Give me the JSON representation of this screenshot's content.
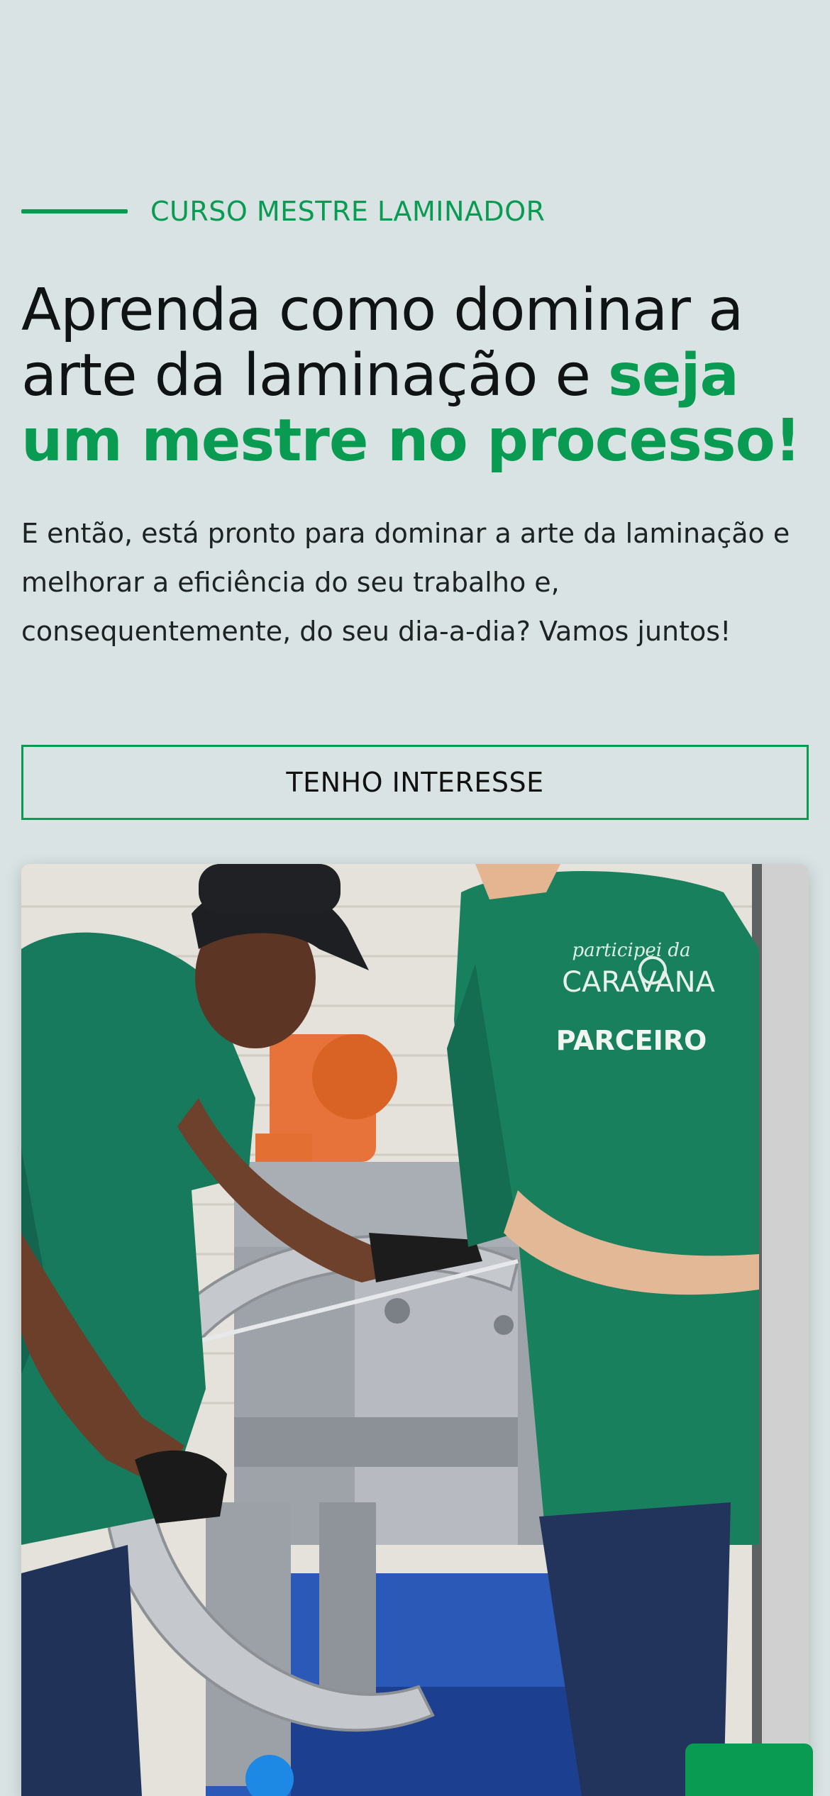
{
  "hero": {
    "eyebrow": "CURSO MESTRE LAMINADOR",
    "headline_plain": "Aprenda como dominar a arte da laminação e ",
    "headline_accent": "seja um mestre no processo!",
    "lead": "E então, está pronto para dominar a arte da laminação e melhorar a eficiência do seu trabalho e, consequentemente, do seu dia-a-dia? Vamos juntos!",
    "cta_label": "TENHO INTERESSE"
  },
  "photo": {
    "shirt_print_1": "participei da",
    "shirt_print_2": "CARAVANA",
    "shirt_print_3": "PARCEIRO"
  },
  "colors": {
    "background": "#d9e3e3",
    "accent": "#0a9b52",
    "text": "#0f1313"
  }
}
